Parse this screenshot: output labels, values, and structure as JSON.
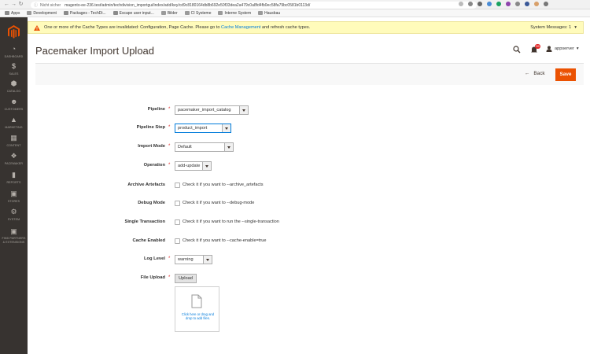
{
  "browser": {
    "security": "Nicht sicher",
    "url": "magento-ee-236.test/admin/techdivision_importgui/index/add/key/cd9c8180164db8b692e50f33dea2a479c0a8fd4fb0ec58fa79bc0581b0113d/",
    "bookmarks": [
      "Apps",
      "Development",
      "Packages - TechDi...",
      "Escape user input...",
      "Bilder",
      "CI Systeme",
      "Interne System",
      "Hausbau"
    ]
  },
  "sidebar": {
    "items": [
      {
        "label": "Dashboard",
        "icon": "dashboard-icon"
      },
      {
        "label": "Sales",
        "icon": "dollar-icon"
      },
      {
        "label": "Catalog",
        "icon": "cube-icon"
      },
      {
        "label": "Customers",
        "icon": "customers-icon"
      },
      {
        "label": "Marketing",
        "icon": "megaphone-icon"
      },
      {
        "label": "Content",
        "icon": "content-icon"
      },
      {
        "label": "Pacemaker",
        "icon": "pacemaker-icon"
      },
      {
        "label": "Reports",
        "icon": "bar-chart-icon"
      },
      {
        "label": "Stores",
        "icon": "store-icon"
      },
      {
        "label": "System",
        "icon": "gear-icon"
      },
      {
        "label": "Find Partners & Extensions",
        "icon": "partners-icon"
      }
    ]
  },
  "notice": {
    "text_before": "One or more of the Cache Types are invalidated: Configuration, Page Cache. Please go to",
    "link": "Cache Management",
    "text_after": "and refresh cache types.",
    "system_messages": "System Messages: 1"
  },
  "header": {
    "title": "Pacemaker Import Upload",
    "notifications": "39",
    "user": "appserver"
  },
  "actions": {
    "back": "Back",
    "save": "Save"
  },
  "form": {
    "pipeline": {
      "label": "Pipeline",
      "value": "pacemaker_import_catalog"
    },
    "pipeline_step": {
      "label": "Pipeline Step",
      "value": "product_import"
    },
    "import_mode": {
      "label": "Import Mode",
      "value": "Default"
    },
    "operation": {
      "label": "Operation",
      "value": "add-update"
    },
    "archive_artefacts": {
      "label": "Archive Artefacts",
      "hint": "Check it if you want to --archive_artefacts"
    },
    "debug_mode": {
      "label": "Debug Mode",
      "hint": "Check it if you want to --debug-mode"
    },
    "single_transaction": {
      "label": "Single Transaction",
      "hint": "Check it if you want to run the --single-transaction"
    },
    "cache_enabled": {
      "label": "Cache Enabled",
      "hint": "Check it if you want to --cache-enable=true"
    },
    "log_level": {
      "label": "Log Level",
      "value": "warning"
    },
    "file_upload": {
      "label": "File Upload",
      "button": "Upload",
      "dropzone": "Click here or drag and drop to add files."
    }
  },
  "colors": {
    "sidebar": "#373330",
    "accent": "#eb5202",
    "link": "#007bdb",
    "notice_bg": "#fffbbb"
  }
}
